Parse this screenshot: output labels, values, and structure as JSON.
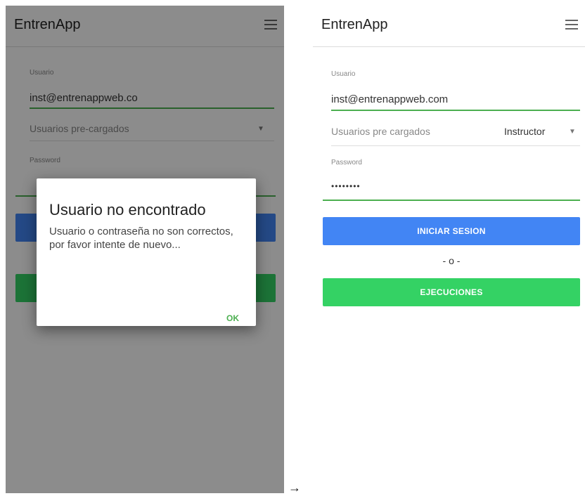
{
  "left_screen": {
    "app_title": "EntrenApp",
    "user_label": "Usuario",
    "user_value": "inst@entrenappweb.co",
    "preloaded_placeholder": "Usuarios pre-cargados",
    "password_label": "Password",
    "dialog": {
      "title": "Usuario no encontrado",
      "message": "Usuario o contraseña no son correctos, por favor intente de nuevo...",
      "ok_label": "OK"
    }
  },
  "arrow": "→",
  "right_screen": {
    "app_title": "EntrenApp",
    "user_label": "Usuario",
    "user_value": "inst@entrenappweb.com",
    "preloaded_placeholder": "Usuarios pre cargados",
    "preloaded_selected": "Instructor",
    "password_label": "Password",
    "password_value": "••••••••",
    "login_button": "INICIAR SESION",
    "or_divider": "- o -",
    "executions_button": "EJECUCIONES"
  },
  "colors": {
    "primary_blue": "#4285f4",
    "success_green": "#34d264",
    "underline_green": "#4caf50"
  }
}
